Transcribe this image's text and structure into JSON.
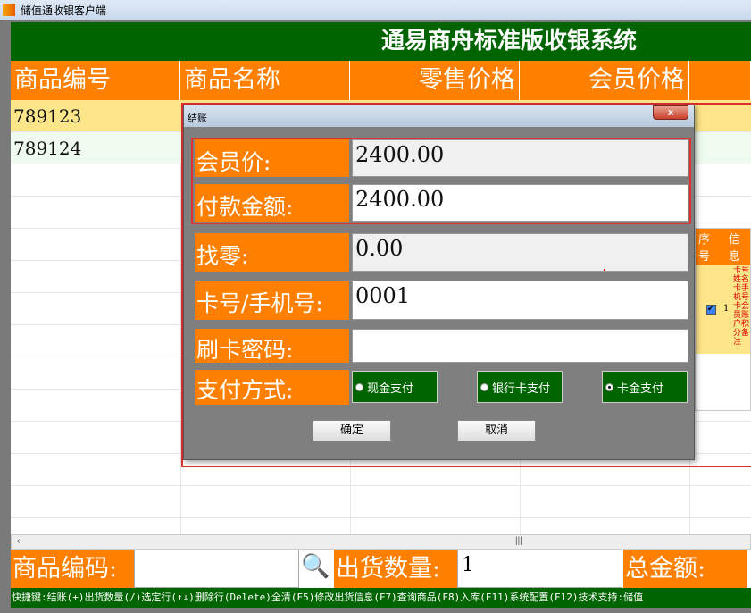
{
  "window": {
    "title": "储值通收银客户端"
  },
  "banner": {
    "title": "通易商舟标准版收银系统"
  },
  "table": {
    "headers": [
      "商品编号",
      "商品名称",
      "零售价格",
      "会员价格"
    ],
    "rows": [
      {
        "code": "789123"
      },
      {
        "code": "789124"
      }
    ]
  },
  "bottom": {
    "code_label": "商品编码:",
    "code_value": "",
    "qty_label": "出货数量:",
    "qty_value": "1",
    "total_label": "总金额:"
  },
  "status": "快捷键:结账(+)出货数量(/)选定行(↑↓)删除行(Delete)全清(F5)修改出货信息(F7)查询商品(F8)入库(F11)系统配置(F12)技术支持:储值",
  "side": {
    "headers": [
      "序号",
      "信息"
    ],
    "row_index": "1",
    "row_text": "卡号姓名卡手机号卡会员账户积分备注"
  },
  "dialog": {
    "title": "结账",
    "close": "x",
    "fields": [
      {
        "label": "会员价:",
        "value": "2400.00"
      },
      {
        "label": "付款金额:",
        "value": "2400.00"
      },
      {
        "label": "找零:",
        "value": "0.00"
      },
      {
        "label": "卡号/手机号:",
        "value": "0001"
      },
      {
        "label": "刷卡密码:",
        "value": ""
      }
    ],
    "pay_label": "支付方式:",
    "pay_options": [
      "现金支付",
      "银行卡支付",
      "卡金支付"
    ],
    "pay_selected": "卡金支付",
    "ok": "确定",
    "cancel": "取消"
  }
}
